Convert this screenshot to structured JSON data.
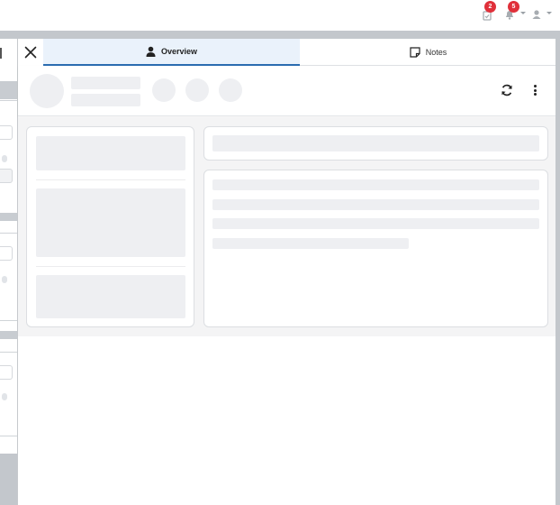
{
  "topbar": {
    "tasks_badge": "2",
    "notifications_badge": "5"
  },
  "tabs": {
    "overview_label": "Overview",
    "notes_label": "Notes"
  },
  "colors": {
    "accent": "#2b6cb0",
    "badge": "#e0303a",
    "skeleton": "#eeeff2",
    "panel_bg": "#f4f4f5"
  },
  "icons": [
    "close-icon",
    "user-icon",
    "note-icon",
    "refresh-icon",
    "more-vertical-icon",
    "tasks-icon",
    "bell-icon",
    "account-icon"
  ]
}
